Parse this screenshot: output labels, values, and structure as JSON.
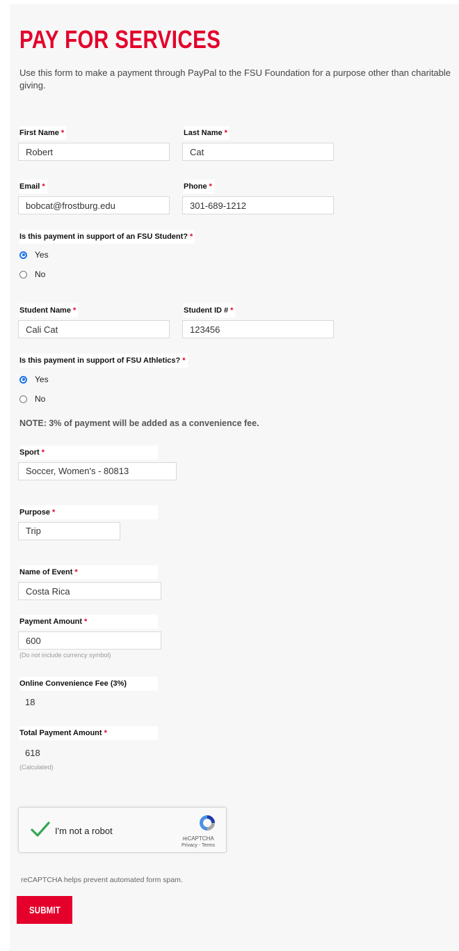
{
  "page": {
    "title": "PAY FOR SERVICES",
    "intro": "Use this form to make a payment through PayPal to the FSU Foundation for a purpose other than charitable giving."
  },
  "required_marker": "*",
  "fields": {
    "first_name": {
      "label": "First Name",
      "value": "Robert"
    },
    "last_name": {
      "label": "Last Name",
      "value": "Cat"
    },
    "email": {
      "label": "Email",
      "value": "bobcat@frostburg.edu"
    },
    "phone": {
      "label": "Phone",
      "value": "301-689-1212"
    },
    "student_name": {
      "label": "Student Name",
      "value": "Cali Cat"
    },
    "student_id": {
      "label": "Student ID #",
      "value": "123456"
    },
    "sport": {
      "label": "Sport",
      "value": "Soccer, Women's - 80813"
    },
    "purpose": {
      "label": "Purpose",
      "value": "Trip"
    },
    "event_name": {
      "label": "Name of Event",
      "value": "Costa Rica"
    },
    "payment_amount": {
      "label": "Payment Amount",
      "value": "600",
      "hint": "(Do not include currency symbol)"
    },
    "convenience_fee": {
      "label": "Online Convenience Fee (3%)",
      "value": "18"
    },
    "total_amount": {
      "label": "Total Payment Amount",
      "value": "618",
      "hint": "(Calculated)"
    }
  },
  "questions": {
    "student_support": {
      "label": "Is this payment in support of an FSU Student?",
      "options": [
        {
          "label": "Yes",
          "checked": true
        },
        {
          "label": "No",
          "checked": false
        }
      ]
    },
    "athletics_support": {
      "label": "Is this payment in support of FSU Athletics?",
      "options": [
        {
          "label": "Yes",
          "checked": true
        },
        {
          "label": "No",
          "checked": false
        }
      ]
    }
  },
  "note": "NOTE: 3% of payment will be added as a convenience fee.",
  "recaptcha": {
    "label": "I'm not a robot",
    "brand": "reCAPTCHA",
    "links": "Privacy - Terms",
    "note": "reCAPTCHA helps prevent automated form spam.",
    "check_icon": "checkmark-icon",
    "check_color": "#34a853"
  },
  "submit_label": "SUBMIT",
  "colors": {
    "accent": "#e4002b",
    "radio": "#1a73e8"
  }
}
